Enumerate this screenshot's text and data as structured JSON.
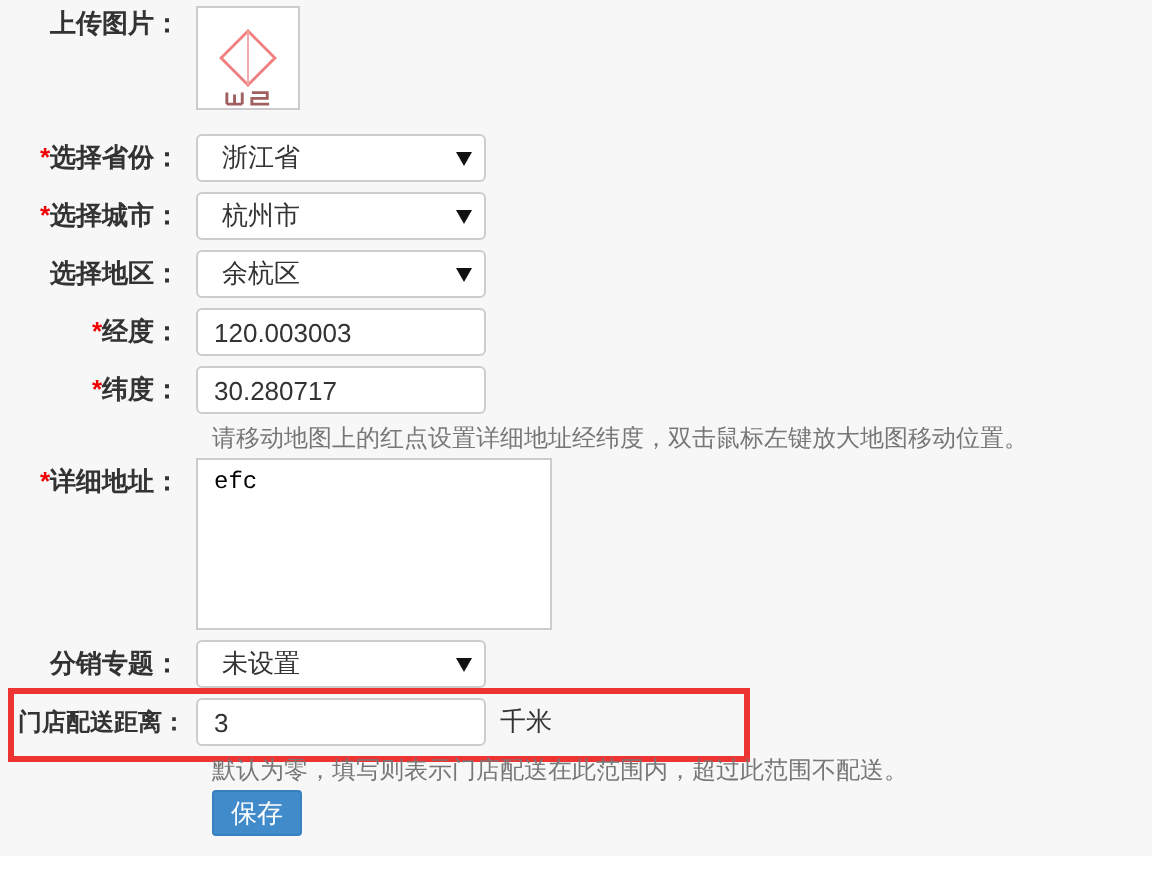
{
  "upload": {
    "label": "上传图片："
  },
  "fields": [
    {
      "kind": "select",
      "marker": "*",
      "label": "选择省份：",
      "value": "浙江省",
      "highlighted": false
    },
    {
      "kind": "select",
      "marker": "*",
      "label": "选择城市：",
      "value": "杭州市",
      "highlighted": false
    },
    {
      "kind": "select",
      "label": "选择地区：",
      "value": "余杭区",
      "highlighted": false
    },
    {
      "kind": "text",
      "marker": "*",
      "label": "经度：",
      "value": "120.003003",
      "highlighted": false
    },
    {
      "kind": "text",
      "marker": "*",
      "label": "纬度：",
      "value": "30.280717",
      "highlighted": false
    },
    {
      "kind": "hint",
      "text": "请移动地图上的红点设置详细地址经纬度，双击鼠标左键放大地图移动位置。"
    },
    {
      "kind": "textarea",
      "marker": "*",
      "label": "详细地址：",
      "value": "efc",
      "highlighted": false
    },
    {
      "kind": "select",
      "label": "分销专题：",
      "value": "未设置",
      "highlighted": false
    },
    {
      "kind": "text",
      "label": "门店配送距离：",
      "value": "3",
      "unit": "千米",
      "highlighted": true
    },
    {
      "kind": "hint",
      "text": "默认为零，填写则表示门店配送在此范围内，超过此范围不配送。"
    },
    {
      "kind": "button",
      "text": "保存"
    }
  ]
}
